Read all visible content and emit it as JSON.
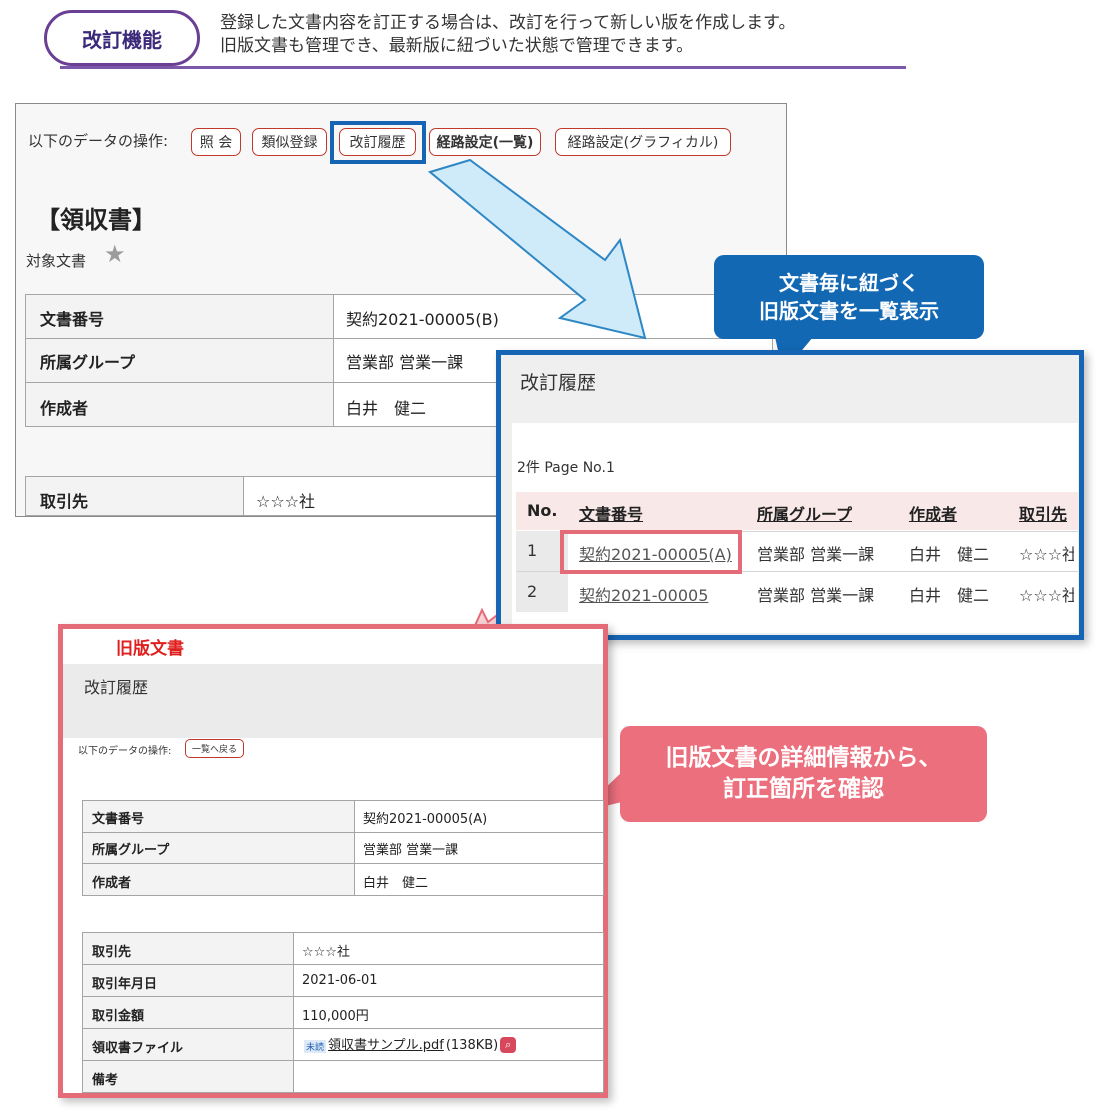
{
  "header": {
    "pill_label": "改訂機能",
    "desc_line1": "登録した文書内容を訂正する場合は、改訂を行って新しい版を作成します。",
    "desc_line2": "旧版文書も管理でき、最新版に紐づいた状態で管理できます。"
  },
  "main_window": {
    "ops_label": "以下のデータの操作:",
    "buttons": [
      "照 会",
      "類似登録",
      "改訂履歴",
      "経路設定(一覧)",
      "経路設定(グラフィカル)"
    ],
    "doc_title": "【領収書】",
    "target_label": "対象文書",
    "fields": [
      {
        "name": "文書番号",
        "value": "契約2021-00005(B)"
      },
      {
        "name": "所属グループ",
        "value": "営業部 営業一課"
      },
      {
        "name": "作成者",
        "value": "白井　健二"
      },
      {
        "name": "取引先",
        "value": "☆☆☆社"
      }
    ]
  },
  "callout_blue": {
    "line1": "文書毎に紐づく",
    "line2": "旧版文書を一覧表示"
  },
  "history_window": {
    "title": "改訂履歴",
    "count": "2件 Page No.1",
    "columns": [
      "No.",
      "文書番号",
      "所属グループ",
      "作成者",
      "取引先"
    ],
    "rows": [
      {
        "no": "1",
        "doc": "契約2021-00005(A)",
        "group": "営業部 営業一課",
        "author": "白井　健二",
        "partner": "☆☆☆社"
      },
      {
        "no": "2",
        "doc": "契約2021-00005",
        "group": "営業部 営業一課",
        "author": "白井　健二",
        "partner": "☆☆☆社"
      }
    ]
  },
  "callout_red": {
    "line1": "旧版文書の詳細情報から、",
    "line2": "訂正箇所を確認"
  },
  "old_window": {
    "label": "旧版文書",
    "title": "改訂履歴",
    "ops_label": "以下のデータの操作:",
    "back_button": "一覧へ戻る",
    "fields_top": [
      {
        "name": "文書番号",
        "value": "契約2021-00005(A)"
      },
      {
        "name": "所属グループ",
        "value": "営業部 営業一課"
      },
      {
        "name": "作成者",
        "value": "白井　健二"
      }
    ],
    "fields_bottom": [
      {
        "name": "取引先",
        "value": "☆☆☆社"
      },
      {
        "name": "取引年月日",
        "value": "2021-06-01"
      },
      {
        "name": "取引金額",
        "value": "110,000円"
      },
      {
        "name": "領収書ファイル",
        "value": ""
      },
      {
        "name": "備考",
        "value": ""
      }
    ],
    "file_badge": "未読",
    "file_name": "領収書サンプル.pdf",
    "file_size": "(138KB)"
  },
  "colors": {
    "accent_purple": "#6a3f94",
    "blue": "#1565b4",
    "red": "#e46b78",
    "callout_red": "#ec6f7d"
  }
}
